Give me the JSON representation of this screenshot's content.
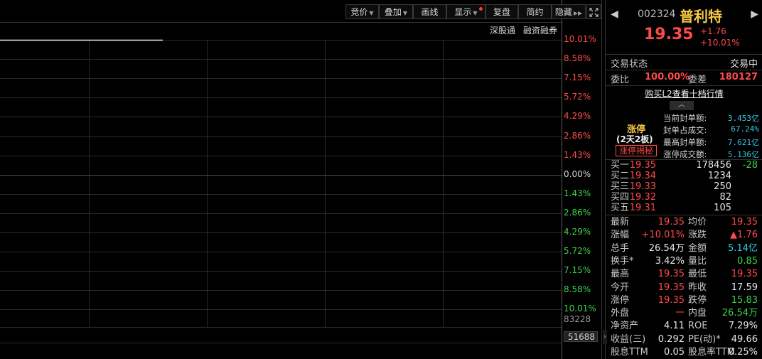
{
  "toolbar": {
    "bidding": "竞价",
    "overlay": "叠加",
    "draw_line": "画线",
    "display": "显示",
    "review": "复盘",
    "simple": "简约",
    "hide": "隐藏"
  },
  "tags": {
    "shenzhen_connect": "深股通",
    "margin_trading": "融资融券"
  },
  "price_axis": {
    "labels": [
      "10.01%",
      "8.58%",
      "7.15%",
      "5.72%",
      "4.29%",
      "2.86%",
      "1.43%",
      "0.00%",
      "1.43%",
      "2.86%",
      "4.29%",
      "5.72%",
      "7.15%",
      "8.58%",
      "10.01%"
    ]
  },
  "volume_axis": {
    "top": "83228",
    "marker": "51688"
  },
  "stock": {
    "code": "002324",
    "name": "普利特",
    "price": "19.35",
    "change": "+1.76",
    "change_pct": "+10.01%"
  },
  "trade_status": {
    "label": "交易状态",
    "value": "交易中"
  },
  "order_ratio": {
    "label": "委比",
    "value": "100.00%",
    "diff_label": "委差",
    "diff_value": "180127"
  },
  "level2_link": "购买L2查看十档行情",
  "limit_up": {
    "title": "涨停",
    "days": "(2天2板)",
    "secret_button": "涨停揭秘",
    "stats": [
      {
        "label": "当前封单额:",
        "value": "3.453亿"
      },
      {
        "label": "封单占成交:",
        "value": "67.24%"
      },
      {
        "label": "最高封单额:",
        "value": "7.621亿"
      },
      {
        "label": "涨停成交额:",
        "value": "5.136亿"
      }
    ]
  },
  "bids": [
    {
      "label": "买一",
      "price": "19.35",
      "volume": "178456",
      "change": "-28"
    },
    {
      "label": "买二",
      "price": "19.34",
      "volume": "1234",
      "change": ""
    },
    {
      "label": "买三",
      "price": "19.33",
      "volume": "250",
      "change": ""
    },
    {
      "label": "买四",
      "price": "19.32",
      "volume": "82",
      "change": ""
    },
    {
      "label": "买五",
      "price": "19.31",
      "volume": "105",
      "change": ""
    }
  ],
  "quote": [
    {
      "l1": "最新",
      "v1": "19.35",
      "c1": "red",
      "l2": "均价",
      "v2": "19.35",
      "c2": "red"
    },
    {
      "l1": "涨幅",
      "v1": "+10.01%",
      "c1": "red",
      "l2": "涨跌",
      "v2": "▲1.76",
      "c2": "red"
    },
    {
      "l1": "总手",
      "v1": "26.54万",
      "c1": "white",
      "l2": "金额",
      "v2": "5.14亿",
      "c2": "cyan"
    },
    {
      "l1": "换手*",
      "v1": "3.42%",
      "c1": "white",
      "l2": "量比",
      "v2": "0.85",
      "c2": "green"
    },
    {
      "l1": "最高",
      "v1": "19.35",
      "c1": "red",
      "l2": "最低",
      "v2": "19.35",
      "c2": "red"
    },
    {
      "l1": "今开",
      "v1": "19.35",
      "c1": "red",
      "l2": "昨收",
      "v2": "17.59",
      "c2": "white"
    },
    {
      "l1": "涨停",
      "v1": "19.35",
      "c1": "red",
      "l2": "跌停",
      "v2": "15.83",
      "c2": "green"
    },
    {
      "l1": "外盘",
      "v1": "一",
      "c1": "red",
      "l2": "内盘",
      "v2": "26.54万",
      "c2": "green"
    },
    {
      "l1": "净资产",
      "v1": "4.11",
      "c1": "white",
      "l2": "ROE",
      "v2": "7.29%",
      "c2": "white"
    },
    {
      "l1": "收益(三)",
      "v1": "0.292",
      "c1": "white",
      "l2": "PE(动)*",
      "v2": "49.66",
      "c2": "white"
    },
    {
      "l1": "股息TTM",
      "v1": "0.05",
      "c1": "white",
      "l2": "股息率TTM",
      "v2": "0.25%",
      "c2": "white"
    }
  ],
  "colors": {
    "up": "#ff4a4a",
    "down": "#3bd449",
    "grid": "#2a2a2a",
    "axis": "#5a5a5a"
  }
}
